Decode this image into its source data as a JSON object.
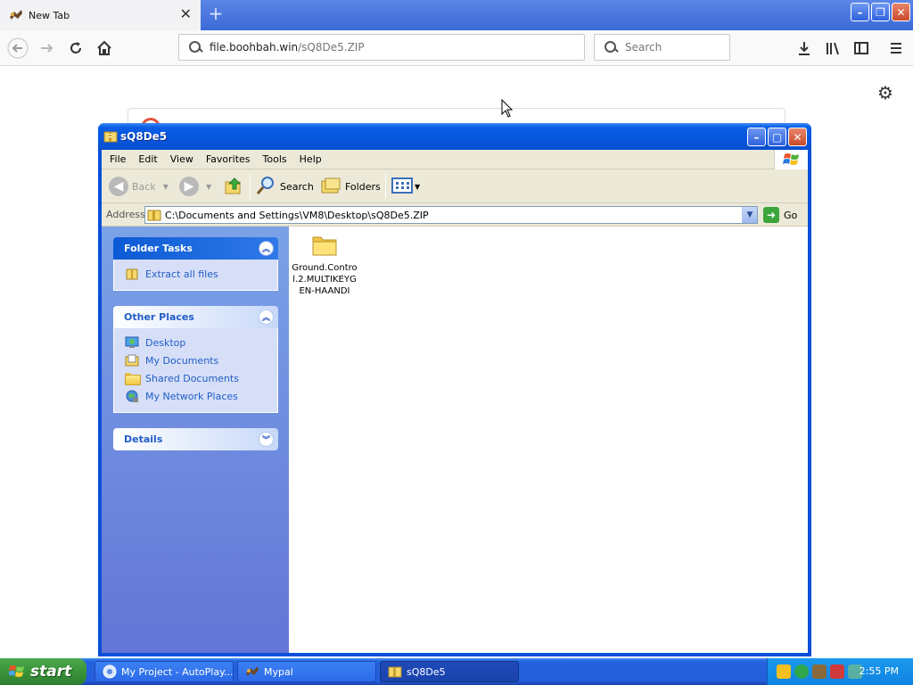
{
  "browser": {
    "tab_title": "New Tab",
    "tab_close": "✕",
    "new_tab": "+",
    "url_host": "file.boohbah.win",
    "url_path": "/sQ8De5.ZIP",
    "search_placeholder": "Search"
  },
  "explorer": {
    "title": "sQ8De5",
    "menu": [
      "File",
      "Edit",
      "View",
      "Favorites",
      "Tools",
      "Help"
    ],
    "toolbar": {
      "back": "Back",
      "search": "Search",
      "folders": "Folders"
    },
    "address_label": "Address",
    "address_value": "C:\\Documents and Settings\\VM8\\Desktop\\sQ8De5.ZIP",
    "go_label": "Go",
    "folder_tasks": {
      "title": "Folder Tasks",
      "items": [
        "Extract all files"
      ]
    },
    "other_places": {
      "title": "Other Places",
      "items": [
        "Desktop",
        "My Documents",
        "Shared Documents",
        "My Network Places"
      ]
    },
    "details": {
      "title": "Details"
    },
    "content_items": [
      {
        "name": "Ground.Control.2.MULTIKEYGEN-HAANDI",
        "icon": "folder-icon"
      }
    ]
  },
  "taskbar": {
    "start_label": "start",
    "tasks": [
      {
        "label": "My Project - AutoPlay..."
      },
      {
        "label": "Mypal"
      },
      {
        "label": "sQ8De5"
      }
    ],
    "clock": "2:55 PM"
  },
  "colors": {
    "xp_blue": "#0c4fd8",
    "task_pane_top": "#7ba2e7",
    "task_pane_bottom": "#6375d6",
    "link_blue": "#215dc6",
    "start_green": "#3a943a",
    "firefox_tabbar": "#3c6ad6"
  }
}
